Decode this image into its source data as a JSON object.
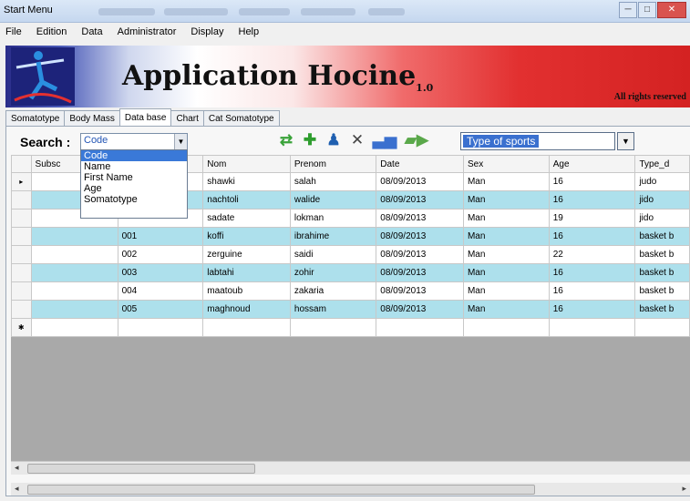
{
  "window": {
    "title": "Start Menu",
    "controls": [
      "─",
      "□",
      "✕"
    ]
  },
  "menu": [
    "File",
    "Edition",
    "Data",
    "Administrator",
    "Display",
    "Help"
  ],
  "banner": {
    "title": "Application Hocine",
    "version": "1.0",
    "rights": "All rights reserved"
  },
  "tabs": [
    "Somatotype",
    "Body Mass",
    "Data base",
    "Chart",
    "Cat Somatotype"
  ],
  "active_tab": "Data base",
  "search": {
    "label": "Search :",
    "selected": "Code",
    "options": [
      "Code",
      "Name",
      "First Name",
      "Age",
      "Somatotype"
    ]
  },
  "toolbar_icons": [
    "refresh-icon",
    "add-icon",
    "add-user-icon",
    "delete-icon",
    "chart-icon",
    "export-icon"
  ],
  "sports_select": {
    "value": "Type of sports"
  },
  "grid": {
    "columns": [
      "",
      "Subsc",
      "",
      "Nom",
      "Prenom",
      "Date",
      "Sex",
      "Age",
      "Type_d"
    ],
    "rows": [
      [
        "▸",
        "",
        "",
        "shawki",
        "salah",
        "08/09/2013",
        "Man",
        "16",
        "judo"
      ],
      [
        "",
        "",
        "",
        "nachtoli",
        "walide",
        "08/09/2013",
        "Man",
        "16",
        "jido"
      ],
      [
        "",
        "",
        "",
        "sadate",
        "lokman",
        "08/09/2013",
        "Man",
        "19",
        "jido"
      ],
      [
        "",
        "",
        "001",
        "koffi",
        "ibrahime",
        "08/09/2013",
        "Man",
        "16",
        "basket b"
      ],
      [
        "",
        "",
        "002",
        "zerguine",
        "saidi",
        "08/09/2013",
        "Man",
        "22",
        "basket b"
      ],
      [
        "",
        "",
        "003",
        "labtahi",
        "zohir",
        "08/09/2013",
        "Man",
        "16",
        "basket b"
      ],
      [
        "",
        "",
        "004",
        "maatoub",
        "zakaria",
        "08/09/2013",
        "Man",
        "16",
        "basket b"
      ],
      [
        "",
        "",
        "005",
        "maghnoud",
        "hossam",
        "08/09/2013",
        "Man",
        "16",
        "basket b"
      ],
      [
        "✱",
        "",
        "",
        "",
        "",
        "",
        "",
        "",
        ""
      ]
    ]
  },
  "colors": {
    "row_highlight": "#ade0ec",
    "grid_empty": "#a9a9a9",
    "selection": "#3a79d8"
  }
}
